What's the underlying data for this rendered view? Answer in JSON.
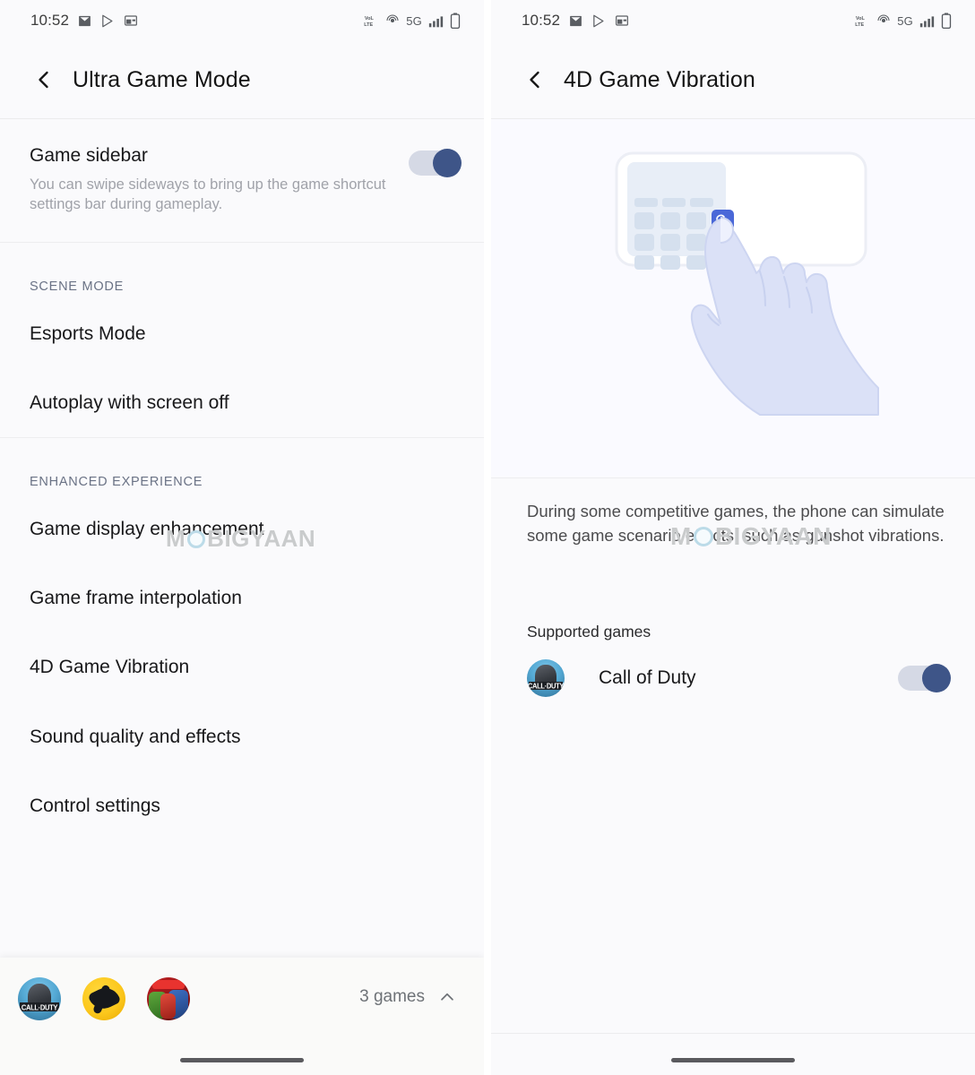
{
  "status_bar": {
    "time": "10:52",
    "left_icons": [
      "mail-icon",
      "play-store-icon",
      "widget-icon"
    ],
    "network_label": "5G",
    "right_icons": [
      "volte-icon",
      "hotspot-icon",
      "signal-bars-icon",
      "battery-icon"
    ]
  },
  "left_screen": {
    "title": "Ultra Game Mode",
    "back_icon": "back-chevron-icon",
    "game_sidebar": {
      "title": "Game sidebar",
      "description": "You can swipe sideways to bring up the game shortcut settings bar during gameplay.",
      "toggle_state": "on"
    },
    "sections": [
      {
        "header": "SCENE MODE",
        "items": [
          {
            "label": "Esports Mode"
          },
          {
            "label": "Autoplay with screen off"
          }
        ]
      },
      {
        "header": "ENHANCED EXPERIENCE",
        "items": [
          {
            "label": "Game display enhancement"
          },
          {
            "label": "Game frame interpolation"
          },
          {
            "label": "4D Game Vibration"
          },
          {
            "label": "Sound quality and effects"
          },
          {
            "label": "Control settings"
          }
        ]
      }
    ],
    "games_bar": {
      "count_label": "3 games",
      "expand_icon": "chevron-up-icon",
      "games": [
        {
          "name": "Call of Duty",
          "icon": "call-of-duty-icon",
          "badge_text": "CALL·DUTY"
        },
        {
          "name": "Yellow Game",
          "icon": "yellow-game-icon"
        },
        {
          "name": "Marvel Game",
          "icon": "marvel-game-icon"
        }
      ]
    }
  },
  "right_screen": {
    "title": "4D Game Vibration",
    "back_icon": "back-chevron-icon",
    "illustration": "hand-tapping-phone-illustration",
    "description": "During some competitive games, the phone can simulate some game scenario effects, such as gunshot vibrations.",
    "supported_label": "Supported games",
    "supported_games": [
      {
        "name": "Call of Duty",
        "icon": "call-of-duty-icon",
        "badge_text": "CALL·DUTY",
        "toggle_state": "on"
      }
    ]
  },
  "watermark": {
    "before": "M",
    "after": "BIGYAAN"
  },
  "colors": {
    "accent_toggle": "#3e5588",
    "toggle_track": "#d5d9e5",
    "section_header": "#6a7285",
    "page_background": "#fafafc",
    "illustration_accent": "#4a68d8"
  }
}
